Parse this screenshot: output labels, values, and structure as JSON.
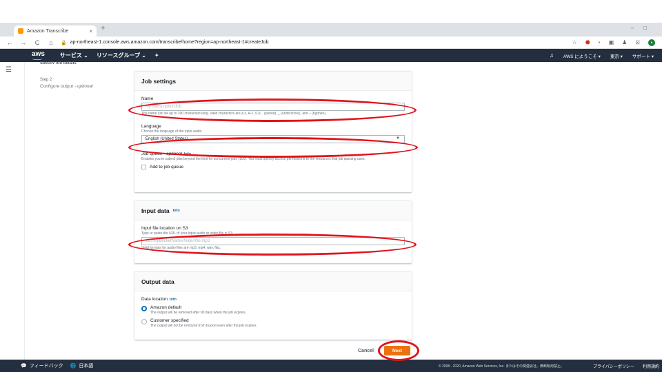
{
  "browser": {
    "tab_title": "Amazon Transcribe",
    "tab_close": "×",
    "new_tab": "+",
    "window_controls": "–□",
    "url": "ap-northeast-1.console.aws.amazon.com/transcribe/home?region=ap-northeast-1#createJob"
  },
  "aws_header": {
    "logo": "aws",
    "services": "サービス ⌄",
    "resource_groups": "リソースグループ ⌄",
    "pin": "✦",
    "bell": "🔔",
    "welcome": "AWS にようこそ ▾",
    "region": "東京 ▾",
    "support": "サポート ▾"
  },
  "sidebar": {
    "cut_heading": "Specify job details",
    "step2_num": "Step 2",
    "step2_desc_prefix": "Configure output - ",
    "step2_desc_optional": "optional"
  },
  "job_settings": {
    "title": "Job settings",
    "name_label": "Name",
    "name_placeholder": "MyTranscriptionJob",
    "name_desc": "The name can be up to 200 characters long. Valid characters are a-z, A-Z, 0-9, . (period), _ (underscore), and – (hyphen).",
    "language_label": "Language",
    "language_desc": "Choose the language of the input audio.",
    "language_value": "English (United States)",
    "queue_label": "Job queue - ",
    "queue_label_optional": "optional",
    "queue_info": "Info",
    "queue_desc": "Enables you to submit jobs beyond the limit for concurrent jobs (100). You must specify access permissions to the resources that job queuing uses.",
    "queue_checkbox": "Add to job queue"
  },
  "input_data": {
    "title": "Input data",
    "info": "Info",
    "s3_label": "Input file location on S3",
    "s3_desc": "Type or paste the URL of your input audio or video file in S3.",
    "s3_placeholder": "s3://MyBucketName/folder/file.mp3",
    "s3_valid": "Valid formats for audio files are mp3, mp4, wav, flac."
  },
  "output_data": {
    "title": "Output data",
    "location_label": "Data location",
    "location_info": "Info",
    "opt1": "Amazon default",
    "opt1_desc": "The output will be removed after 90 days when the job expires.",
    "opt2": "Customer specified",
    "opt2_desc": "The output will not be removed from bucket even after the job expires."
  },
  "actions": {
    "cancel": "Cancel",
    "next": "Next"
  },
  "footer": {
    "feedback": "フィードバック",
    "language": "日本語",
    "copyright": "© 2008 - 2020, Amazon Web Services, Inc. またはその関連会社。無断転用禁止。",
    "privacy": "プライバシーポリシー",
    "terms": "利用規約"
  },
  "colors": {
    "aws_header": "#232f3e",
    "next_button": "#ec7211",
    "annotation": "#e0131c",
    "link": "#0073bb"
  }
}
